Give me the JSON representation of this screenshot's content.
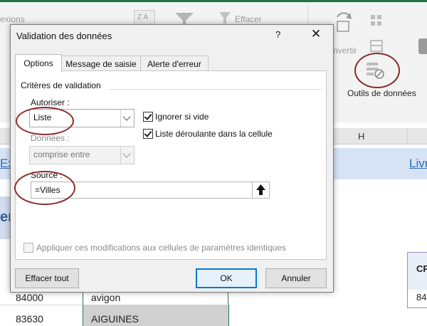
{
  "excel": {
    "ribbon": {
      "connexions": "exions",
      "sort_az": "Z A",
      "effacer": "Effacer",
      "convertir": "nvertir",
      "outils": "Outils de données"
    },
    "column_h": "H",
    "banner_left": "Ex",
    "banner_right": "Livr",
    "title_fragment": "er",
    "cp_header": "CP",
    "cp_value": "84",
    "rows": [
      {
        "code": "84000",
        "city": "avigon"
      },
      {
        "code": "83630",
        "city": "AIGUINES"
      }
    ]
  },
  "dialog": {
    "title": "Validation des données",
    "help": "?",
    "close": "✕",
    "tabs": [
      "Options",
      "Message de saisie",
      "Alerte d'erreur"
    ],
    "group_title": "Critères de validation",
    "autoriser_label": "Autoriser :",
    "autoriser_value": "Liste",
    "donnees_label": "Données :",
    "donnees_value": "comprise entre",
    "ignorer_label": "Ignorer si vide",
    "liste_label": "Liste déroulante dans la cellule",
    "source_label": "Source :",
    "source_value": "=Villes",
    "appliquer_label": "Appliquer ces modifications aux cellules de paramètres identiques",
    "btn_effacer": "Effacer tout",
    "btn_ok": "OK",
    "btn_annuler": "Annuler"
  }
}
